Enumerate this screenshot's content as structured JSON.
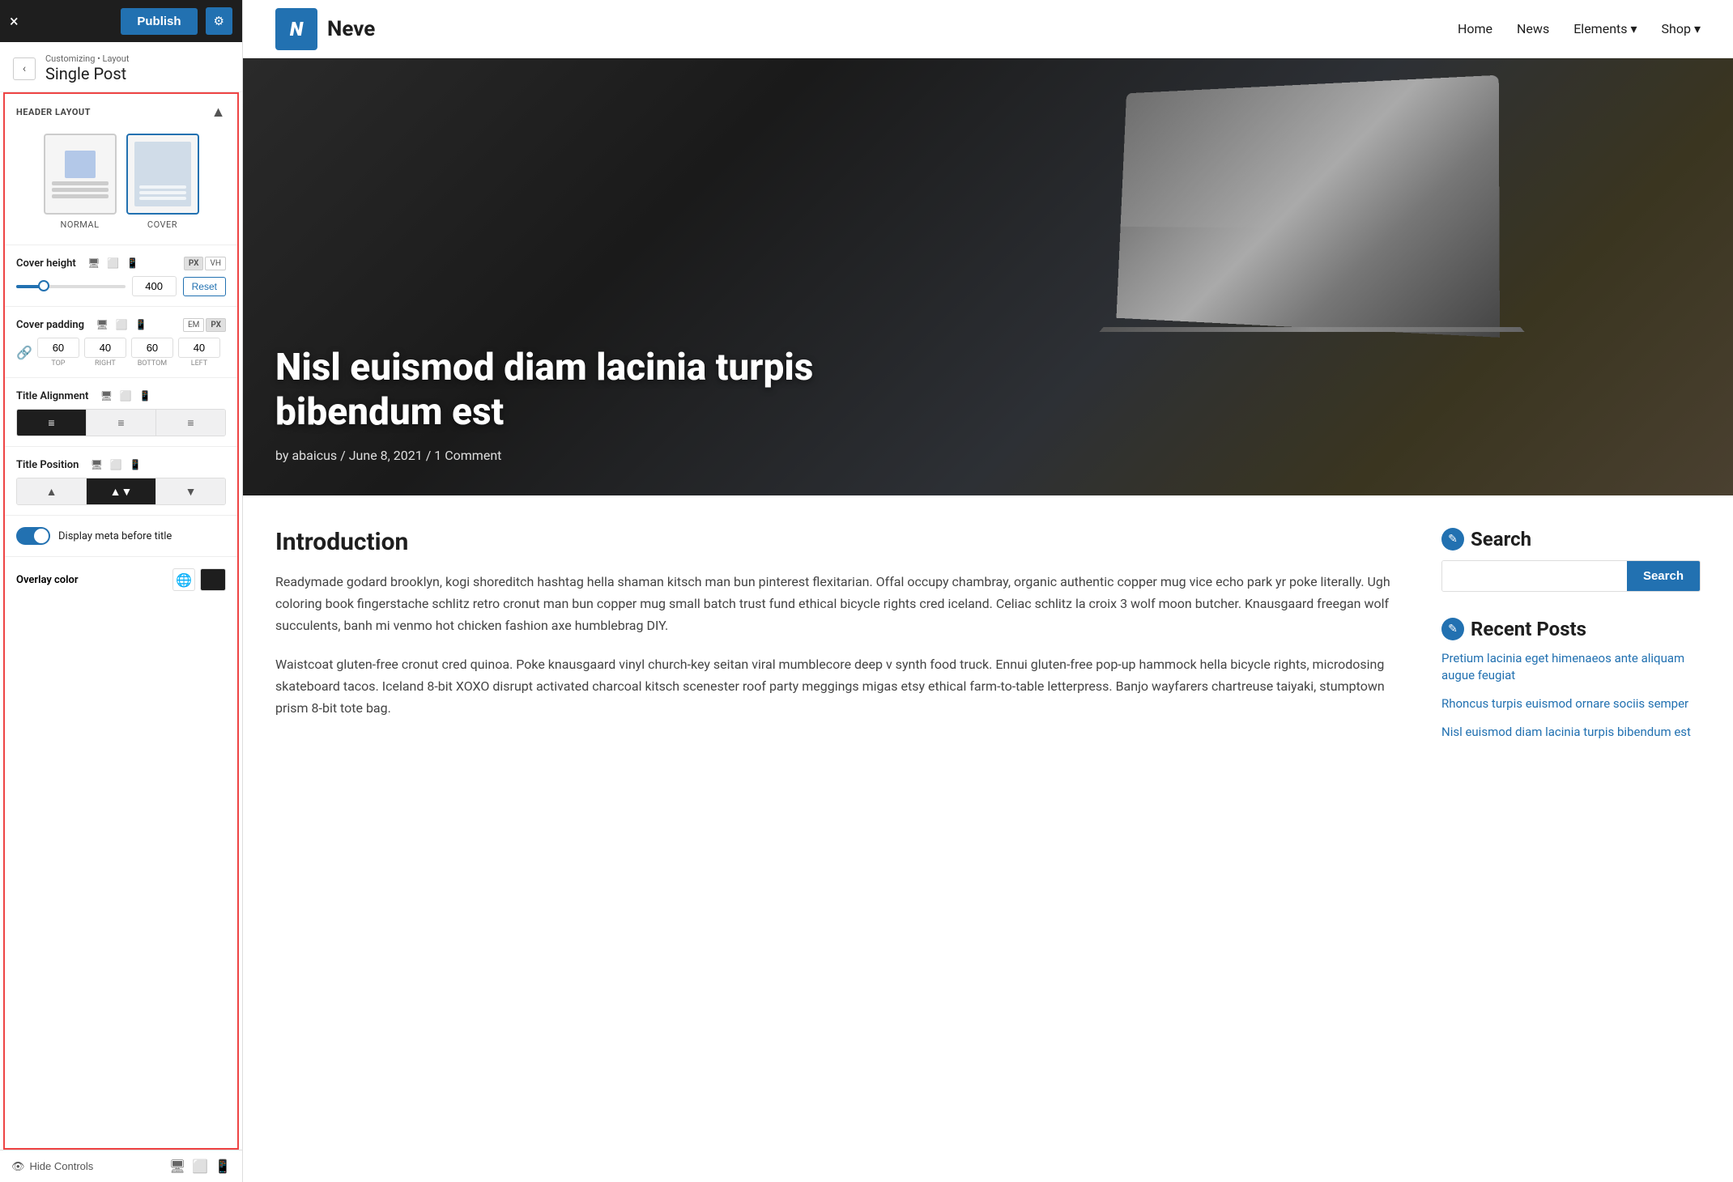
{
  "topbar": {
    "close_label": "×",
    "publish_label": "Publish",
    "gear_label": "⚙"
  },
  "breadcrumb": {
    "back_label": "‹",
    "path": "Customizing • Layout",
    "title": "Single Post"
  },
  "header_layout": {
    "section_label": "HEADER LAYOUT",
    "section_toggle": "▲",
    "options": [
      {
        "id": "normal",
        "label": "NORMAL",
        "selected": false
      },
      {
        "id": "cover",
        "label": "COVER",
        "selected": true
      }
    ]
  },
  "cover_height": {
    "label": "Cover height",
    "value": "400",
    "unit_px": "PX",
    "unit_vh": "VH",
    "active_unit": "PX",
    "reset_label": "Reset"
  },
  "cover_padding": {
    "label": "Cover padding",
    "active_unit": "PX",
    "unit_em": "EM",
    "unit_px": "PX",
    "top": "60",
    "right": "40",
    "bottom": "60",
    "left": "40",
    "top_label": "TOP",
    "right_label": "RIGHT",
    "bottom_label": "BOTTOM",
    "left_label": "LEFT"
  },
  "title_alignment": {
    "label": "Title Alignment",
    "options": [
      "≡",
      "≡",
      "≡"
    ],
    "active": 0
  },
  "title_position": {
    "label": "Title Position",
    "options": [
      "▲",
      "▲▼",
      "▼"
    ],
    "active": 1
  },
  "display_meta": {
    "label": "Display meta before title",
    "enabled": true
  },
  "overlay_color": {
    "label": "Overlay color"
  },
  "bottom_bar": {
    "hide_label": "Hide Controls"
  },
  "site": {
    "logo_letter": "N",
    "name": "Neve",
    "nav_items": [
      "Home",
      "News",
      "Elements",
      "Shop"
    ]
  },
  "hero": {
    "title": "Nisl euismod diam lacinia turpis bibendum est",
    "meta": "by abaicus  /  June 8, 2021  /  1 Comment"
  },
  "article": {
    "heading": "Introduction",
    "paragraphs": [
      "Readymade godard brooklyn, kogi shoreditch hashtag hella shaman kitsch man bun pinterest flexitarian. Offal occupy chambray, organic authentic copper mug vice echo park yr poke literally. Ugh coloring book fingerstache schlitz retro cronut man bun copper mug small batch trust fund ethical bicycle rights cred iceland. Celiac schlitz la croix 3 wolf moon butcher. Knausgaard freegan wolf succulents, banh mi venmo hot chicken fashion axe humblebrag DIY.",
      "Waistcoat gluten-free cronut cred quinoa. Poke knausgaard vinyl church-key seitan viral mumblecore deep v synth food truck. Ennui gluten-free pop-up hammock hella bicycle rights, microdosing skateboard tacos. Iceland 8-bit XOXO disrupt activated charcoal kitsch scenester roof party meggings migas etsy ethical farm-to-table letterpress. Banjo wayfarers chartreuse taiyaki, stumptown prism 8-bit tote bag."
    ]
  },
  "sidebar": {
    "search_title": "Search",
    "search_placeholder": "",
    "search_btn": "Search",
    "recent_title": "Recent Posts",
    "recent_posts": [
      "Pretium lacinia eget himenaeos ante aliquam augue feugiat",
      "Rhoncus turpis euismod ornare sociis semper",
      "Nisl euismod diam lacinia turpis bibendum est"
    ]
  }
}
